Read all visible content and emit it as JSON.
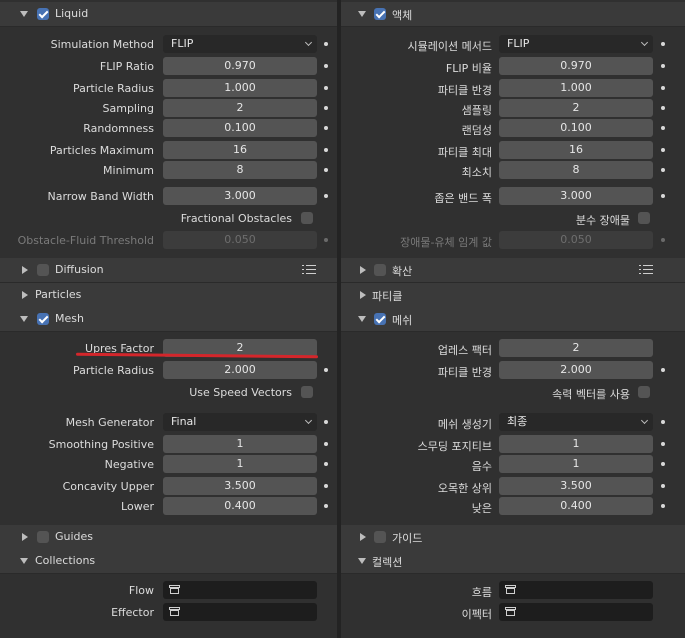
{
  "left": {
    "liquid": "Liquid",
    "simulation_method_label": "Simulation Method",
    "simulation_method_value": "FLIP",
    "flip_ratio_label": "FLIP Ratio",
    "flip_ratio_value": "0.970",
    "particle_radius_label": "Particle Radius",
    "particle_radius_value": "1.000",
    "sampling_label": "Sampling",
    "sampling_value": "2",
    "randomness_label": "Randomness",
    "randomness_value": "0.100",
    "particles_maximum_label": "Particles Maximum",
    "particles_maximum_value": "16",
    "minimum_label": "Minimum",
    "minimum_value": "8",
    "narrow_band_label": "Narrow Band Width",
    "narrow_band_value": "3.000",
    "fractional_obstacles_label": "Fractional Obstacles",
    "obstacle_threshold_label": "Obstacle-Fluid Threshold",
    "obstacle_threshold_value": "0.050",
    "diffusion": "Diffusion",
    "particles": "Particles",
    "mesh": "Mesh",
    "upres_label": "Upres Factor",
    "upres_value": "2",
    "mesh_particle_radius_label": "Particle Radius",
    "mesh_particle_radius_value": "2.000",
    "use_speed_vectors_label": "Use Speed Vectors",
    "mesh_generator_label": "Mesh Generator",
    "mesh_generator_value": "Final",
    "smoothing_positive_label": "Smoothing Positive",
    "smoothing_positive_value": "1",
    "negative_label": "Negative",
    "negative_value": "1",
    "concavity_upper_label": "Concavity Upper",
    "concavity_upper_value": "3.500",
    "lower_label": "Lower",
    "lower_value": "0.400",
    "guides": "Guides",
    "collections": "Collections",
    "flow_label": "Flow",
    "effector_label": "Effector"
  },
  "right": {
    "liquid": "액체",
    "simulation_method_label": "시뮬레이션 메서드",
    "simulation_method_value": "FLIP",
    "flip_ratio_label": "FLIP 비율",
    "flip_ratio_value": "0.970",
    "particle_radius_label": "파티클 반경",
    "particle_radius_value": "1.000",
    "sampling_label": "샘플링",
    "sampling_value": "2",
    "randomness_label": "랜덤성",
    "randomness_value": "0.100",
    "particles_maximum_label": "파티클 최대",
    "particles_maximum_value": "16",
    "minimum_label": "최소치",
    "minimum_value": "8",
    "narrow_band_label": "좁은 밴드 폭",
    "narrow_band_value": "3.000",
    "fractional_obstacles_label": "분수 장애물",
    "obstacle_threshold_label": "장애물-유체 임계 값",
    "obstacle_threshold_value": "0.050",
    "diffusion": "확산",
    "particles": "파티클",
    "mesh": "메쉬",
    "upres_label": "업레스 팩터",
    "upres_value": "2",
    "mesh_particle_radius_label": "파티클 반경",
    "mesh_particle_radius_value": "2.000",
    "use_speed_vectors_label": "속력 벡터를 사용",
    "mesh_generator_label": "메쉬 생성기",
    "mesh_generator_value": "최종",
    "smoothing_positive_label": "스무딩 포지티브",
    "smoothing_positive_value": "1",
    "negative_label": "음수",
    "negative_value": "1",
    "concavity_upper_label": "오목한 상위",
    "concavity_upper_value": "3.500",
    "lower_label": "낮은",
    "lower_value": "0.400",
    "guides": "가이드",
    "collections": "컬렉션",
    "flow_label": "흐름",
    "effector_label": "이펙터"
  },
  "colors": {
    "background": "#303030",
    "field": "#545454",
    "checkbox_accent": "#4772b3",
    "annotation": "#d4262b"
  }
}
